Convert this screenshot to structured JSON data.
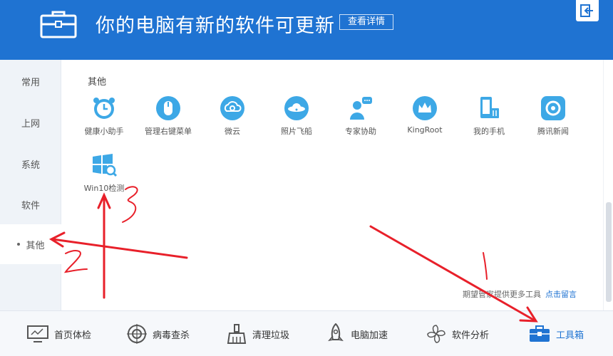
{
  "header": {
    "title": "你的电脑有新的软件可更新",
    "details_button": "查看详情",
    "icon": "toolbox-icon",
    "exit_icon": "exit-icon"
  },
  "sidebar": {
    "items": [
      {
        "label": "常用"
      },
      {
        "label": "上网"
      },
      {
        "label": "系统"
      },
      {
        "label": "软件"
      },
      {
        "label": "其他",
        "active": true
      }
    ]
  },
  "main": {
    "section_title": "其他",
    "tools": [
      {
        "label": "健康小助手",
        "icon": "alarm-clock-icon"
      },
      {
        "label": "管理右键菜单",
        "icon": "mouse-icon"
      },
      {
        "label": "微云",
        "icon": "cloud-icon"
      },
      {
        "label": "照片飞船",
        "icon": "ufo-icon"
      },
      {
        "label": "专家协助",
        "icon": "expert-icon"
      },
      {
        "label": "KingRoot",
        "icon": "crown-icon"
      },
      {
        "label": "我的手机",
        "icon": "phone-icon"
      },
      {
        "label": "腾讯新闻",
        "icon": "news-icon"
      },
      {
        "label": "Win10检测",
        "icon": "windows-search-icon"
      }
    ],
    "hint_text": "期望管家提供更多工具",
    "hint_link": "点击留言"
  },
  "bottom_nav": {
    "items": [
      {
        "label": "首页体检",
        "icon": "monitor-icon"
      },
      {
        "label": "病毒查杀",
        "icon": "target-icon"
      },
      {
        "label": "清理垃圾",
        "icon": "broom-icon"
      },
      {
        "label": "电脑加速",
        "icon": "rocket-icon"
      },
      {
        "label": "软件分析",
        "icon": "pinwheel-icon"
      },
      {
        "label": "工具箱",
        "icon": "toolbox-icon",
        "active": true
      }
    ]
  },
  "annotations": {
    "numbers": [
      "1",
      "2",
      "3"
    ],
    "color": "#e8202a"
  },
  "colors": {
    "accent": "#1f73d2",
    "tool_icon": "#3da8e6"
  }
}
